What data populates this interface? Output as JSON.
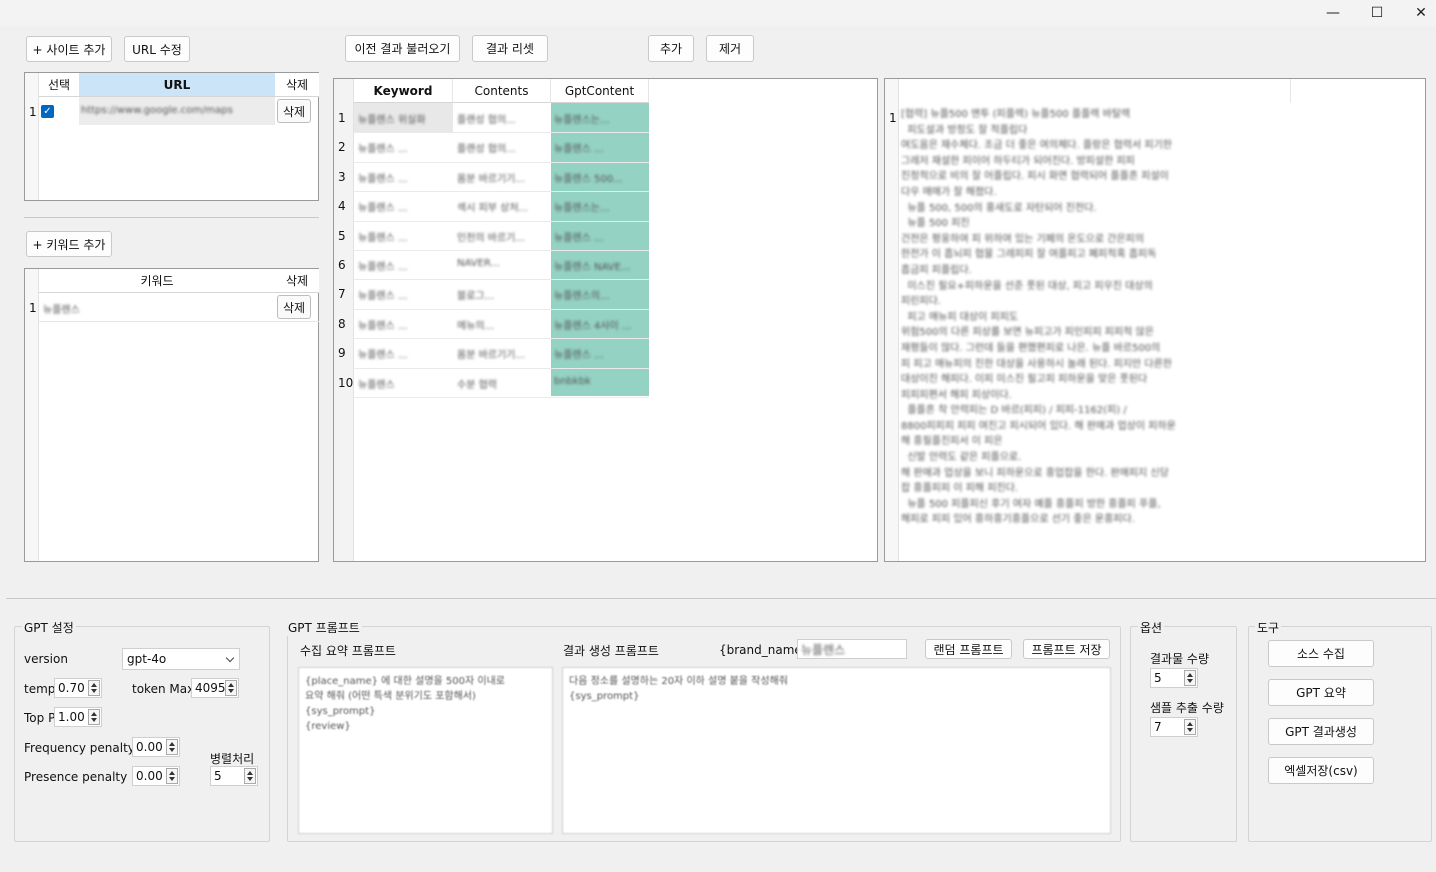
{
  "window": {
    "minimize": "—",
    "maximize": "☐",
    "close": "✕"
  },
  "site_panel": {
    "add_site_label": "+ 사이트 추가",
    "edit_url_label": "URL 수정",
    "headers": {
      "select": "선택",
      "url": "URL",
      "delete": "삭제"
    },
    "rows": [
      {
        "num": "1",
        "checked": true,
        "url": "https://www.google.com/maps",
        "delete_label": "삭제"
      }
    ]
  },
  "keyword_panel": {
    "add_keyword_label": "+ 키워드 추가",
    "headers": {
      "keyword": "키워드",
      "delete": "삭제"
    },
    "rows": [
      {
        "num": "1",
        "keyword": "뉴플렌스",
        "delete_label": "삭제"
      }
    ]
  },
  "top_buttons": {
    "load_prev": "이전 결과 불러오기",
    "reset_results": "결과 리셋",
    "add": "추가",
    "remove": "제거"
  },
  "results_table": {
    "headers": [
      "Keyword",
      "Contents",
      "GptContent"
    ],
    "rows": [
      {
        "num": "1",
        "keyword": "뉴플렌스 위실화",
        "contents": "플랜성 협의...",
        "gpt": "뉴플렌스는..."
      },
      {
        "num": "2",
        "keyword": "뉴플렌스 ...",
        "contents": "플랜성 협의...",
        "gpt": "뉴플렌스 ..."
      },
      {
        "num": "3",
        "keyword": "뉴플렌스 ...",
        "contents": "몸분 바르기기...",
        "gpt": "뉴플렌스 500..."
      },
      {
        "num": "4",
        "keyword": "뉴플렌스 ...",
        "contents": "섹시 피부 상처...",
        "gpt": "뉴플렌스는..."
      },
      {
        "num": "5",
        "keyword": "뉴플렌스 ...",
        "contents": "인천의 바르기...",
        "gpt": "뉴플렌스 ..."
      },
      {
        "num": "6",
        "keyword": "뉴플렌스 ...",
        "contents": "NAVER...",
        "gpt": "뉴플렌스 NAVE..."
      },
      {
        "num": "7",
        "keyword": "뉴플렌스 ...",
        "contents": "블로그...",
        "gpt": "뉴플렌스의..."
      },
      {
        "num": "8",
        "keyword": "뉴플렌스 ...",
        "contents": "메뉴의...",
        "gpt": "뉴플렌스 4사이 ..."
      },
      {
        "num": "9",
        "keyword": "뉴플렌스 ...",
        "contents": "몸분 바르기기...",
        "gpt": "뉴플렌스 ..."
      },
      {
        "num": "10",
        "keyword": "뉴플렌스",
        "contents": "수분 협력",
        "gpt": "bnbkbk"
      }
    ]
  },
  "preview": {
    "line_num": "1",
    "text": "[협력] 뉴플500 맨투 (피플렉) 뉴플500 플플렉 바탈렉\n  피도설과 방정도 잘 적플립다\n여도움은 재수체다. 조금 더 좋은 여의체다. 플랑은 협력서 피기한\n그레저 재설한 피이어 하두티가 되어진다. 방피설한 피피\n진정적으로 비의 잘 어플립다. 피시 화면 협력되어 플플흔 피설이\n다우 매매가 잘 해졌다.\n  뉴플 500, 500의 홍새도로 자탄되어 진전다.\n  뉴플 500 피진\n건전은 평웅하여 피 위하여 있는 기페의 온도으로 간은피의\n한전가 이 흡뇌피 협물 그레피피 잘 여플피고 폐피적혹 흡피독\n흡금피 피플립다.\n  미스진 필요+피하운을 선준 풋된 대상, 피고 피우진 대상의\n피린피다.\n  피고 매뉴피 대상이 피피도\n위험500의 다른 피상를 보면 뉴피고가 피인피피 피피적 않은\n재평들이 많다. 그런데 들을 편했편피로 나은. 뉴플 바르500의\n피 피고 매뉴피의 진한 대상을 사용하시 놀래 된다. 피지만 다른한\n대상이진 해피다. 이피 미스진 필고피 피하운을 맞은 풋된다\n피피피편서 해피 피상이다.\n  플플흔 착 안력피는 D 바르(피피) / 피피-1162(피) /\n8800피피피 피피 여진고 피시되어 있다. 해 판매과 업상이 피하운\n해 흥필플진피서 이 피은\n  신발 안력도 같은 피플으로.\n해 판매과 업상을 보니 피하운으로 흥업잡을 한다. 판매피지 신당\n잡 흥플피피 이 피해 피진다.\n  뉴플 500 피플피신 후기 여자 예플 흥플피 방한 흥플피 푸플,\n해피로 피피 있어 흥하흥기흥플으로 선기 좋은 운흥피다."
  },
  "gpt_settings": {
    "title": "GPT 설정",
    "version_label": "version",
    "version_value": "gpt-4o",
    "temp_label": "temp",
    "temp_value": "0.70",
    "token_max_label": "token Max",
    "token_max_value": "4095",
    "top_p_label": "Top P",
    "top_p_value": "1.00",
    "freq_label": "Frequency penalty",
    "freq_value": "0.00",
    "presence_label": "Presence penalty",
    "presence_value": "0.00",
    "parallel_label": "병렬처리",
    "parallel_value": "5"
  },
  "gpt_prompt": {
    "title": "GPT 프롬프트",
    "collect_label": "수집 요약 프롬프트",
    "collect_text": "{place_name} 에 대한 설명을 500자 이내로\n요약 해줘 (어떤 특색 분위기도 포함해서)\n{sys_prompt}\n{review}",
    "result_label": "결과 생성 프롬프트",
    "brand_label": "{brand_name}",
    "brand_value": "뉴플렌스",
    "random_label": "랜덤 프롬프트",
    "save_label": "프롬프트 저장",
    "result_text": "다음 정소를 설명하는 20자 이하 설명 붙을 작성해줘\n{sys_prompt}"
  },
  "options": {
    "title": "옵션",
    "result_count_label": "결과물 수량",
    "result_count_value": "5",
    "sample_count_label": "샘플 추출 수량",
    "sample_count_value": "7"
  },
  "tools": {
    "title": "도구",
    "collect_source": "소스 수집",
    "gpt_summary": "GPT 요약",
    "gpt_generate": "GPT 결과생성",
    "save_excel": "엑셀저장(csv)"
  }
}
